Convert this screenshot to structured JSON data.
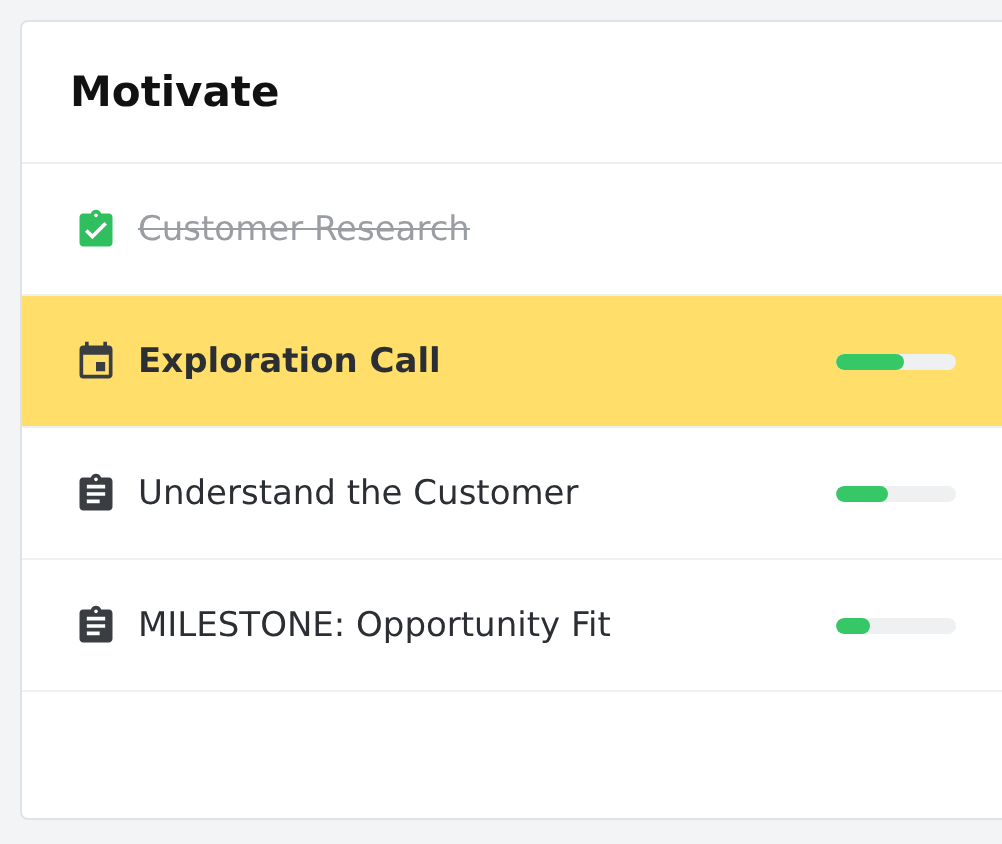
{
  "card": {
    "title": "Motivate"
  },
  "items": [
    {
      "label": "Customer Research",
      "kind": "task",
      "completed": true,
      "selected": false
    },
    {
      "label": "Exploration Call",
      "kind": "call",
      "completed": false,
      "selected": true,
      "level": 0.57
    },
    {
      "label": "Understand the Customer",
      "kind": "task",
      "completed": false,
      "selected": false,
      "level": 0.43
    },
    {
      "label": "MILESTONE: Opportunity Fit",
      "kind": "task",
      "completed": false,
      "selected": false,
      "level": 0.28
    }
  ]
}
